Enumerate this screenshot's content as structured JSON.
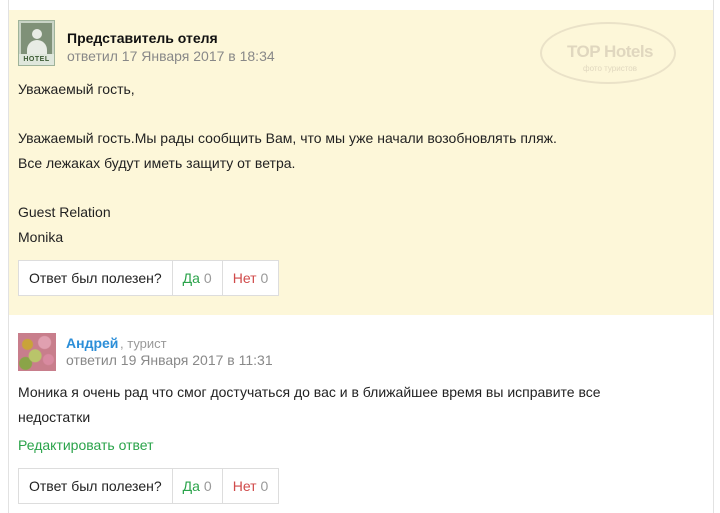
{
  "hotel_reply": {
    "author": "Представитель отеля",
    "date": "ответил 17 Января 2017 в 18:34",
    "avatar_caption": "HOTEL",
    "watermark": "TOP Hotels",
    "watermark_sub": "фото туристов",
    "lines": [
      "Уважаемый гость,",
      "Уважаемый гость.Мы рады сообщить Вам, что мы уже начали возобновлять пляж.",
      "Все лежаках будут иметь защиту от ветра.",
      "Guest Relation",
      "Monika"
    ],
    "helpful": {
      "question": "Ответ был полезен?",
      "yes_label": "Да",
      "yes_count": "0",
      "no_label": "Нет",
      "no_count": "0"
    }
  },
  "user_reply": {
    "author": "Андрей",
    "role": ", турист",
    "date": "ответил 19 Января 2017 в 11:31",
    "lines": [
      "Моника я очень рад что смог достучаться до вас и в ближайшее время вы исправите все",
      "недостатки"
    ],
    "edit_label": "Редактировать ответ",
    "helpful": {
      "question": "Ответ был полезен?",
      "yes_label": "Да",
      "yes_count": "0",
      "no_label": "Нет",
      "no_count": "0"
    }
  }
}
